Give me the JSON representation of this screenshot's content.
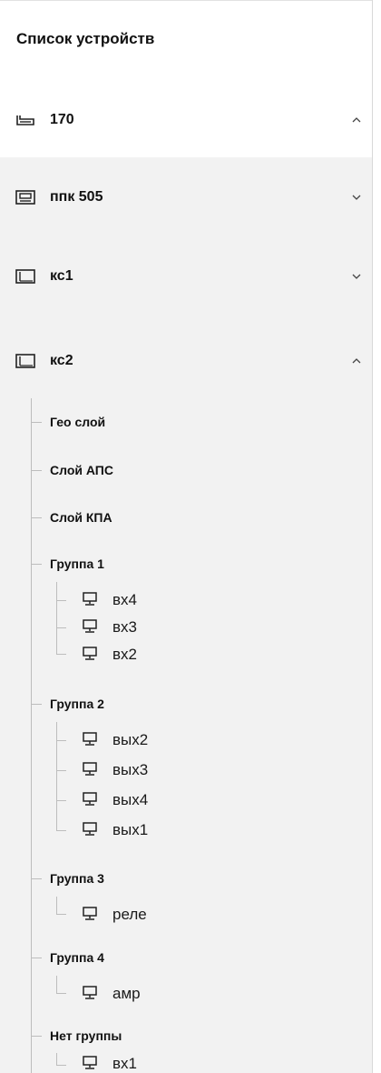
{
  "header": {
    "title": "Список устройств"
  },
  "devices": [
    {
      "label": "170",
      "expanded": true,
      "icon": "switch-icon"
    },
    {
      "label": "ппк 505",
      "expanded": false,
      "icon": "panel-device-icon"
    },
    {
      "label": "кс1",
      "expanded": false,
      "icon": "display-device-icon"
    },
    {
      "label": "кс2",
      "expanded": true,
      "icon": "display-device-icon"
    }
  ],
  "layers": [
    {
      "label": "Гео слой"
    },
    {
      "label": "Слой АПС"
    },
    {
      "label": "Слой КПА"
    }
  ],
  "groups": [
    {
      "label": "Группа 1",
      "items": [
        "вх4",
        "вх3",
        "вх2"
      ]
    },
    {
      "label": "Группа 2",
      "items": [
        "вых2",
        "вых3",
        "вых4",
        "вых1"
      ]
    },
    {
      "label": "Группа 3",
      "items": [
        "реле"
      ]
    },
    {
      "label": "Группа 4",
      "items": [
        "амр"
      ]
    },
    {
      "label": "Нет группы",
      "items": [
        "вх1"
      ]
    }
  ],
  "colors": {
    "selected_background": "#ffffff",
    "list_background": "#f2f2f2",
    "tree_line": "#bdbdbd",
    "text": "#111111"
  }
}
